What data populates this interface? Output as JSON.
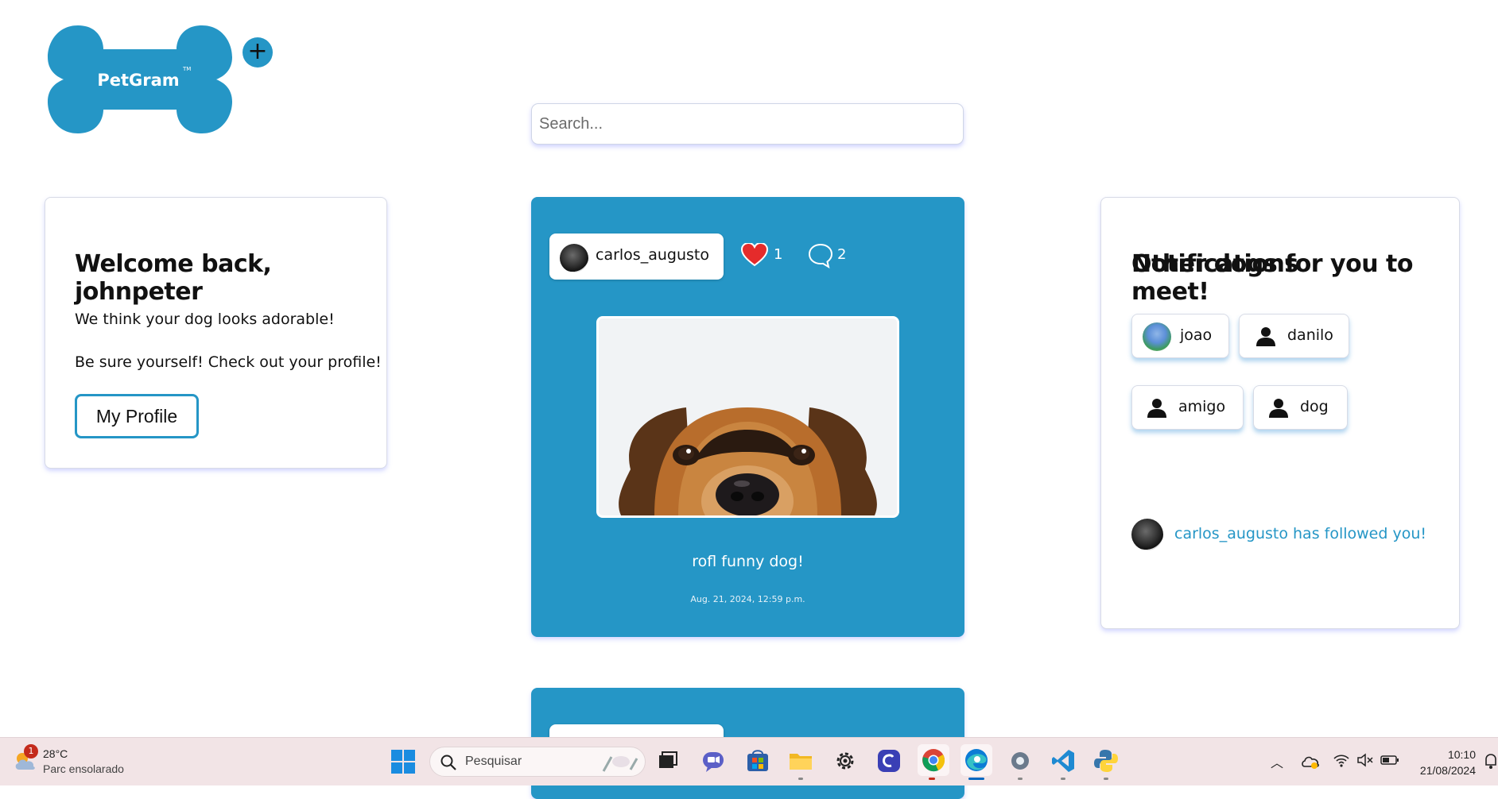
{
  "app": {
    "logo_text": "PetGram",
    "logo_tm": "TM",
    "brand_color": "#2596c6"
  },
  "add_button": {
    "label": "+"
  },
  "search": {
    "placeholder": "Search..."
  },
  "welcome": {
    "title": "Welcome back, johnpeter",
    "line1": "We think your dog looks adorable!",
    "line2": "Be sure yourself! Check out your profile!",
    "profile_button": "My Profile"
  },
  "posts": [
    {
      "author": "carlos_augusto",
      "likes": "1",
      "comments": "2",
      "caption": "rofl funny dog!",
      "date": "Aug. 21, 2024, 12:59 p.m."
    }
  ],
  "meet": {
    "title": "Other dogs for you to meet!",
    "dogs": [
      "joao",
      "danilo",
      "amigo",
      "dog"
    ]
  },
  "notifications": {
    "title": "Notifications",
    "items": [
      "carlos_augusto has followed you!"
    ]
  },
  "taskbar": {
    "weather_badge": "1",
    "temperature": "28°C",
    "condition": "Parc ensolarado",
    "search_placeholder": "Pesquisar",
    "time": "10:10",
    "date": "21/08/2024"
  }
}
